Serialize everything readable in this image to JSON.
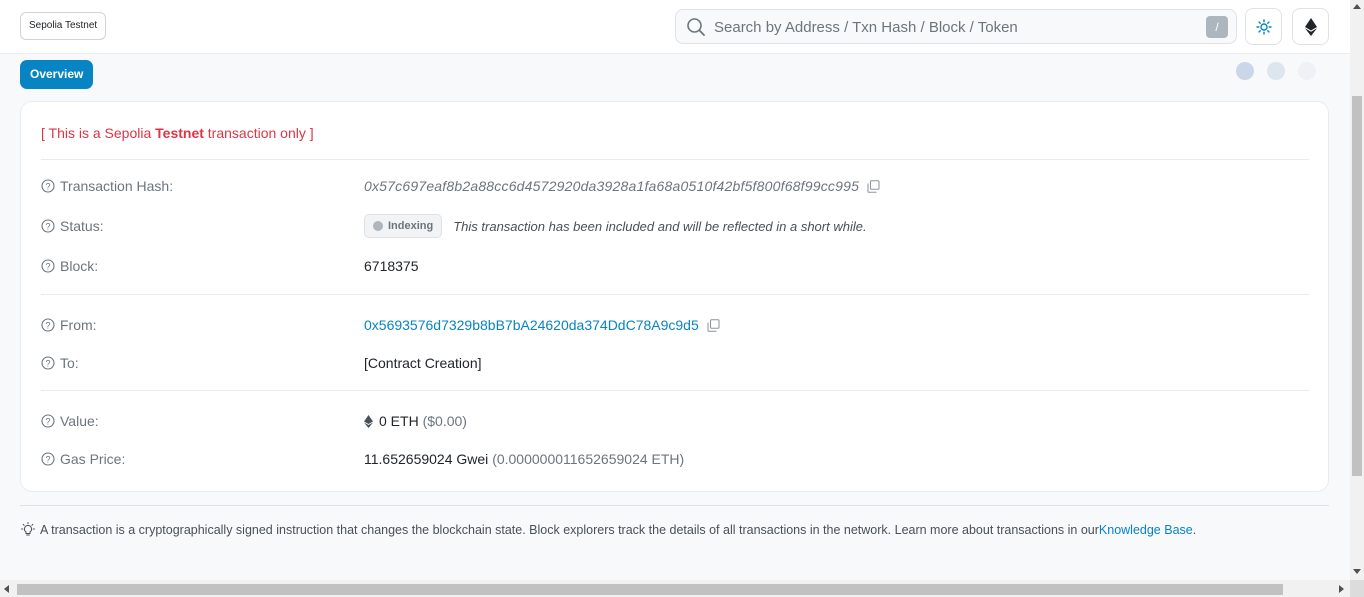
{
  "header": {
    "network_badge": "Sepolia Testnet",
    "search_placeholder": "Search by Address / Txn Hash / Block / Token",
    "search_shortcut": "/"
  },
  "tabs": [
    {
      "label": "Overview",
      "active": true
    }
  ],
  "testnet_note": {
    "prefix": "[ This is a Sepolia ",
    "bold": "Testnet",
    "suffix": " transaction only ]"
  },
  "details": {
    "tx_hash_label": "Transaction Hash:",
    "tx_hash": "0x57c697eaf8b2a88cc6d4572920da3928a1fa68a0510f42bf5f800f68f99cc995",
    "status_label": "Status:",
    "status_badge": "Indexing",
    "status_message": "This transaction has been included and will be reflected in a short while.",
    "block_label": "Block:",
    "block": "6718375",
    "from_label": "From:",
    "from": "0x5693576d7329b8bB7bA24620da374DdC78A9c9d5",
    "to_label": "To:",
    "to": "[Contract Creation]",
    "value_label": "Value:",
    "value": "0 ETH",
    "value_usd": "($0.00)",
    "gas_price_label": "Gas Price:",
    "gas_price": "11.652659024 Gwei",
    "gas_price_eth": "(0.000000011652659024 ETH)"
  },
  "footer": {
    "note": "A transaction is a cryptographically signed instruction that changes the blockchain state. Block explorers track the details of all transactions in the network. Learn more about transactions in our ",
    "link": "Knowledge Base",
    "suffix": "."
  },
  "colors": {
    "accent": "#0784c3",
    "danger": "#dc3545",
    "muted": "#6c757d"
  }
}
